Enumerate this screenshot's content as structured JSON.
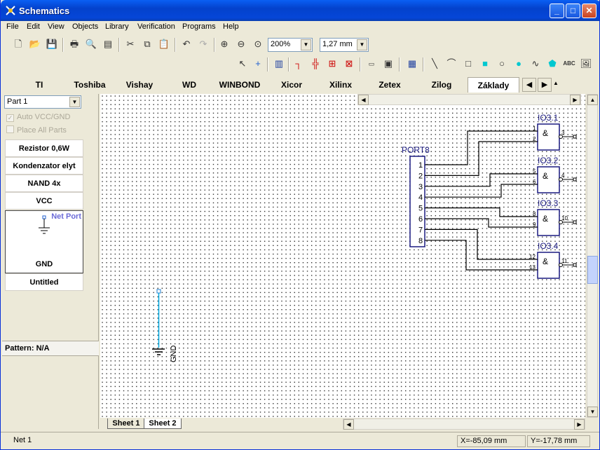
{
  "window": {
    "title": "Schematics"
  },
  "menu": [
    "File",
    "Edit",
    "View",
    "Objects",
    "Library",
    "Verification",
    "Programs",
    "Help"
  ],
  "toolbar": {
    "zoom": "200%",
    "grid": "1,27 mm"
  },
  "tabs": [
    "TI",
    "Toshiba",
    "Vishay",
    "WD",
    "WINBOND",
    "Xicor",
    "Xilinx",
    "Zetex",
    "Zilog",
    "Základy"
  ],
  "left": {
    "part_select": "Part 1",
    "auto_vcc": "Auto VCC/GND",
    "place_all": "Place All Parts",
    "parts": [
      "Rezistor 0,6W",
      "Kondenzator elyt",
      "NAND 4x",
      "VCC"
    ],
    "preview_label": "Net Port",
    "preview_part": "GND",
    "untitled": "Untitled",
    "pattern": "Pattern: N/A"
  },
  "schematic": {
    "port": "PORT8",
    "port_pins": [
      "1",
      "2",
      "3",
      "4",
      "5",
      "6",
      "7",
      "8"
    ],
    "gates": [
      {
        "name": "IO3.1",
        "in": [
          "1",
          "2"
        ],
        "out": "3"
      },
      {
        "name": "IO3.2",
        "in": [
          "5",
          "6"
        ],
        "out": "4"
      },
      {
        "name": "IO3.3",
        "in": [
          "8",
          "9"
        ],
        "out": "10"
      },
      {
        "name": "IO3.4",
        "in": [
          "12",
          "13"
        ],
        "out": "11"
      }
    ],
    "gate_symbol": "&",
    "gnd": "GND"
  },
  "sheets": [
    "Sheet 1",
    "Sheet 2"
  ],
  "status": {
    "net": "Net 1",
    "x": "X=-85,09 mm",
    "y": "Y=-17,78 mm"
  }
}
